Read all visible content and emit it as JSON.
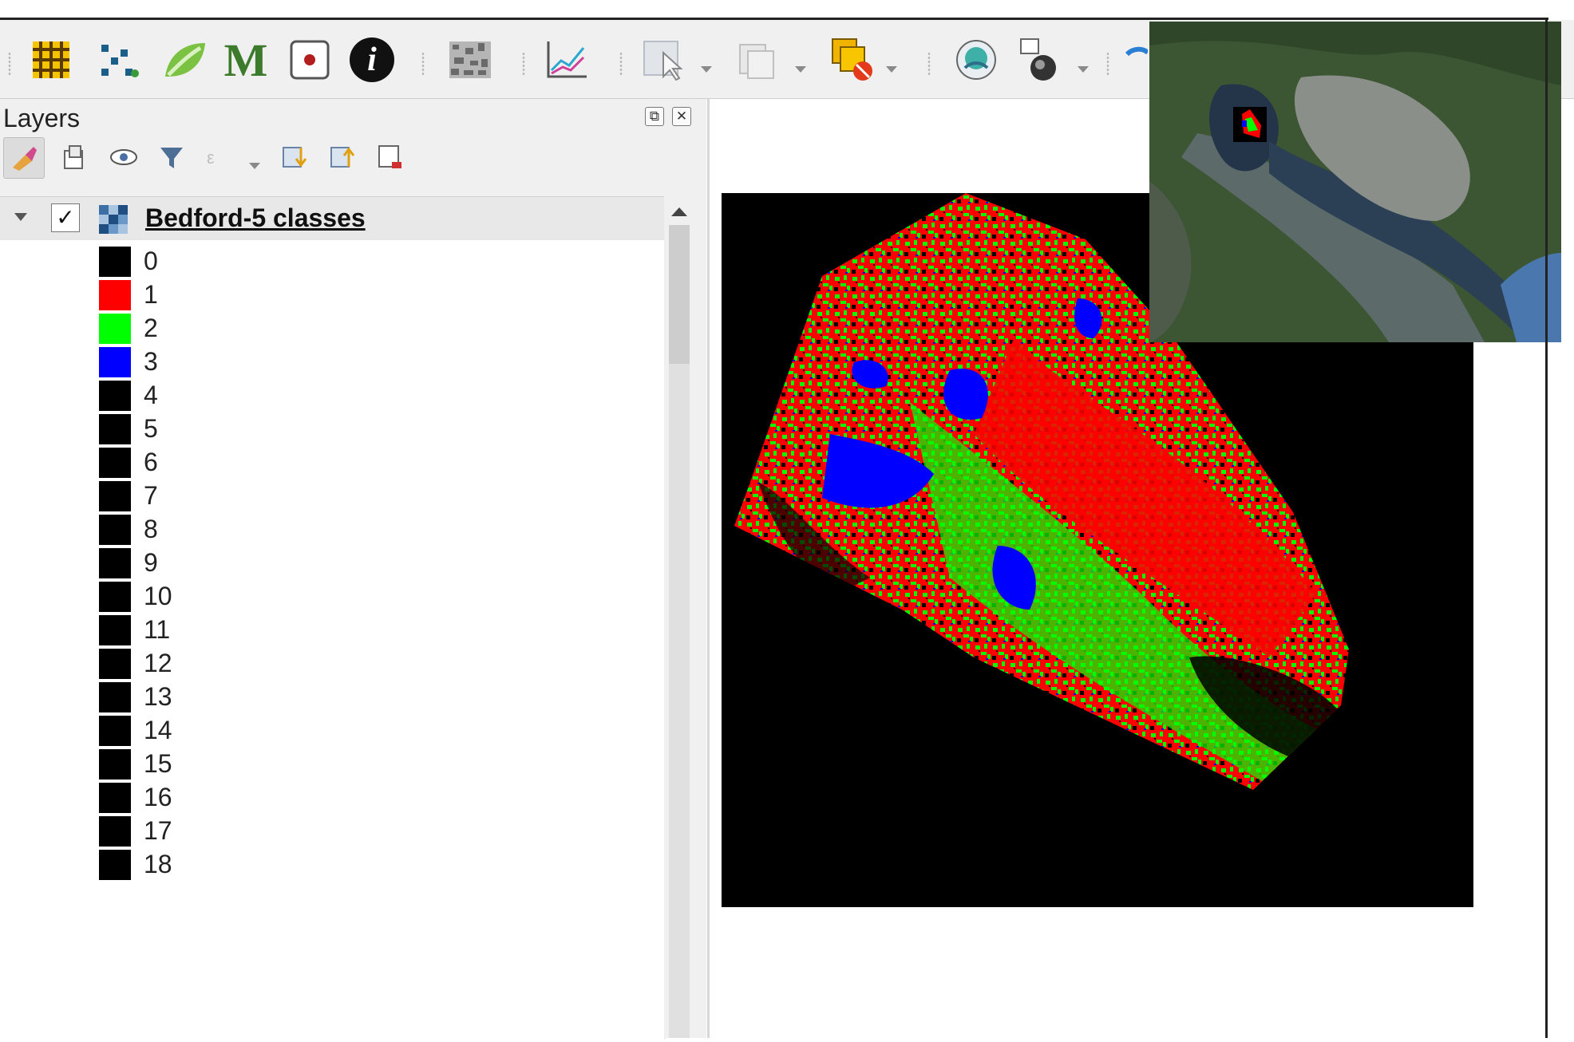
{
  "toolbar": {
    "icons": [
      "grid-icon",
      "xy-points-icon",
      "leaf-icon",
      "m-icon",
      "point-icon",
      "identify-icon",
      "texture-icon",
      "profile-chart-icon",
      "select-icon",
      "copy-layer-icon",
      "remove-layer-icon",
      "globe-icon",
      "raster-transform-icon",
      "add-icon"
    ],
    "m_letter": "M",
    "info_letter": "i"
  },
  "layers_panel": {
    "title": "Layers",
    "float_button": "⧉",
    "close_button": "✕"
  },
  "layer": {
    "name": "Bedford-5 classes",
    "checked": "✓"
  },
  "legend": [
    {
      "label": "0",
      "color": "#000000"
    },
    {
      "label": "1",
      "color": "#ff0000"
    },
    {
      "label": "2",
      "color": "#00ff00"
    },
    {
      "label": "3",
      "color": "#0000ff"
    },
    {
      "label": "4",
      "color": "#000000"
    },
    {
      "label": "5",
      "color": "#000000"
    },
    {
      "label": "6",
      "color": "#000000"
    },
    {
      "label": "7",
      "color": "#000000"
    },
    {
      "label": "8",
      "color": "#000000"
    },
    {
      "label": "9",
      "color": "#000000"
    },
    {
      "label": "10",
      "color": "#000000"
    },
    {
      "label": "11",
      "color": "#000000"
    },
    {
      "label": "12",
      "color": "#000000"
    },
    {
      "label": "13",
      "color": "#000000"
    },
    {
      "label": "14",
      "color": "#000000"
    },
    {
      "label": "15",
      "color": "#000000"
    },
    {
      "label": "16",
      "color": "#000000"
    },
    {
      "label": "17",
      "color": "#000000"
    },
    {
      "label": "18",
      "color": "#000000"
    }
  ],
  "colors": {
    "class_red": "#ff0000",
    "class_green": "#00ff00",
    "class_blue": "#0000ff",
    "background": "#000000"
  }
}
